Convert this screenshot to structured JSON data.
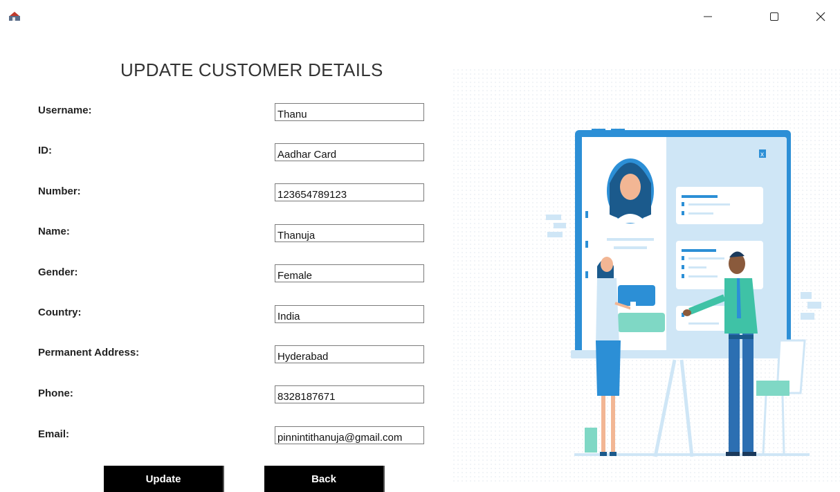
{
  "window": {
    "icon": "java-app-icon",
    "controls": [
      "minimize-icon",
      "maximize-icon",
      "close-icon"
    ]
  },
  "page": {
    "title": "UPDATE CUSTOMER DETAILS"
  },
  "form": {
    "username": {
      "label": "Username:",
      "value": "Thanu"
    },
    "id": {
      "label": "ID:",
      "value": "Aadhar Card"
    },
    "number": {
      "label": "Number:",
      "value": "123654789123"
    },
    "name": {
      "label": "Name:",
      "value": "Thanuja"
    },
    "gender": {
      "label": "Gender:",
      "value": "Female"
    },
    "country": {
      "label": "Country:",
      "value": "India"
    },
    "address": {
      "label": "Permanent Address:",
      "value": "Hyderabad"
    },
    "phone": {
      "label": "Phone:",
      "value": "8328187671"
    },
    "email": {
      "label": "Email:",
      "value": "pinnintithanuja@gmail.com"
    }
  },
  "buttons": {
    "update": "Update",
    "back": "Back"
  },
  "colors": {
    "accent_blue": "#2c8fd6",
    "light_blue": "#cfe6f6",
    "button_bg": "#000000",
    "button_text": "#ffffff"
  },
  "illustration": {
    "type": "customer-profile-board-illustration",
    "close_glyph": "x"
  }
}
